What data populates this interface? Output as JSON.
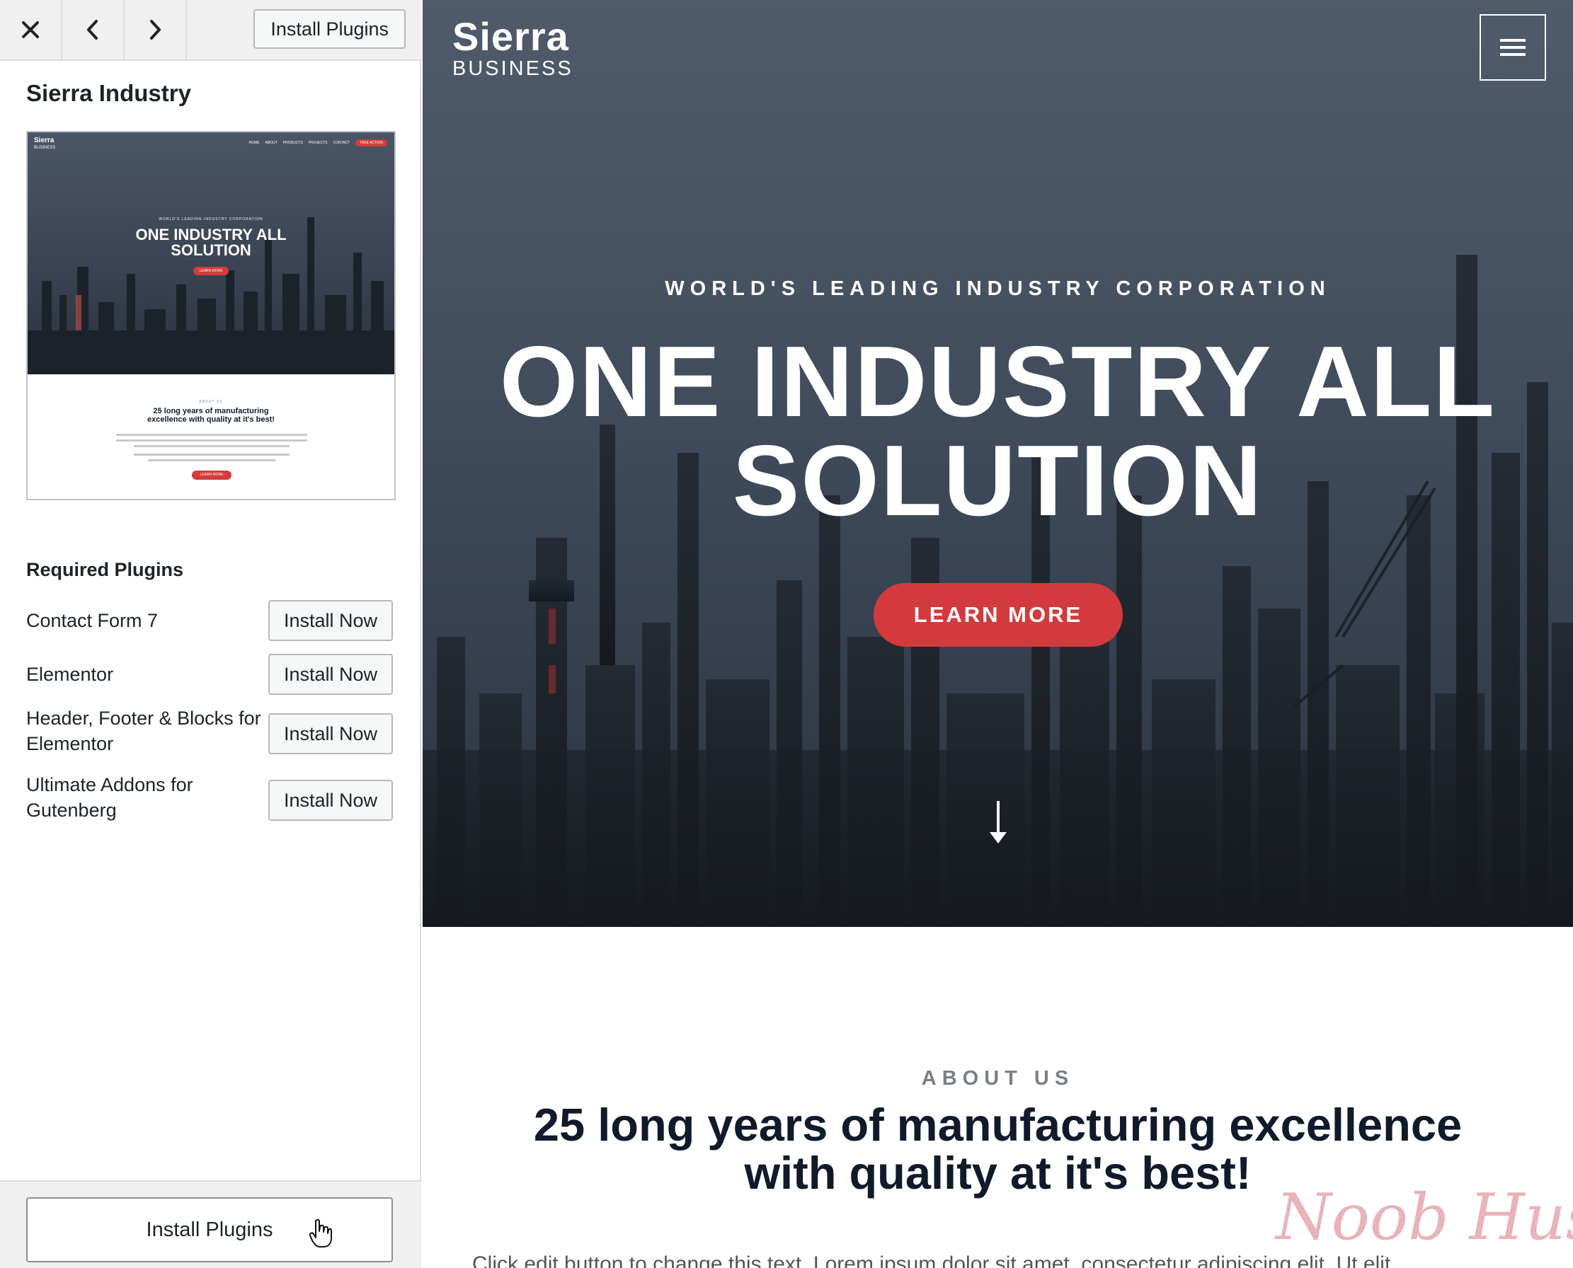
{
  "toolbar": {
    "close_icon": "close-icon",
    "prev_icon": "chevron-left-icon",
    "next_icon": "chevron-right-icon",
    "install_label": "Install Plugins"
  },
  "sidebar": {
    "theme_title": "Sierra Industry",
    "thumbnail": {
      "logo": "Sierra",
      "logo_sub": "BUSINESS",
      "nav": [
        "HOME",
        "ABOUT",
        "PRODUCTS",
        "PROJECTS",
        "CONTACT"
      ],
      "nav_cta": "TAKE ACTION",
      "kicker": "WORLD'S LEADING INDUSTRY CORPORATION",
      "headline_line1": "ONE INDUSTRY ALL",
      "headline_line2": "SOLUTION",
      "button": "LEARN MORE",
      "about_kicker": "ABOUT US",
      "about_title_line1": "25 long years of manufacturing",
      "about_title_line2": "excellence with quality at it's best!",
      "about_button": "LEARN MORE"
    },
    "required_title": "Required Plugins",
    "plugins": [
      {
        "name": "Contact Form 7",
        "button": "Install Now"
      },
      {
        "name": "Elementor",
        "button": "Install Now"
      },
      {
        "name": "Header, Footer & Blocks for Elementor",
        "button": "Install Now"
      },
      {
        "name": "Ultimate Addons for Gutenberg",
        "button": "Install Now"
      }
    ],
    "footer_install_label": "Install Plugins"
  },
  "preview": {
    "brand_name": "Sierra",
    "brand_sub": "BUSINESS",
    "menu_icon": "hamburger-menu-icon",
    "kicker": "WORLD'S LEADING INDUSTRY CORPORATION",
    "headline_line1": "ONE INDUSTRY ALL",
    "headline_line2": "SOLUTION",
    "cta": "LEARN MORE",
    "scroll_icon": "arrow-down-icon",
    "about_kicker": "ABOUT US",
    "about_title_line1": "25 long years of manufacturing excellence",
    "about_title_line2": "with quality at it's best!",
    "about_body": "Click edit button to change this text. Lorem ipsum dolor sit amet, consectetur adipiscing elit. Ut elit"
  },
  "watermark": "Noob Hustle",
  "colors": {
    "accent": "#d43a3d",
    "hero_overlay": "#3a4554",
    "heading_dark": "#0f1b2b"
  }
}
